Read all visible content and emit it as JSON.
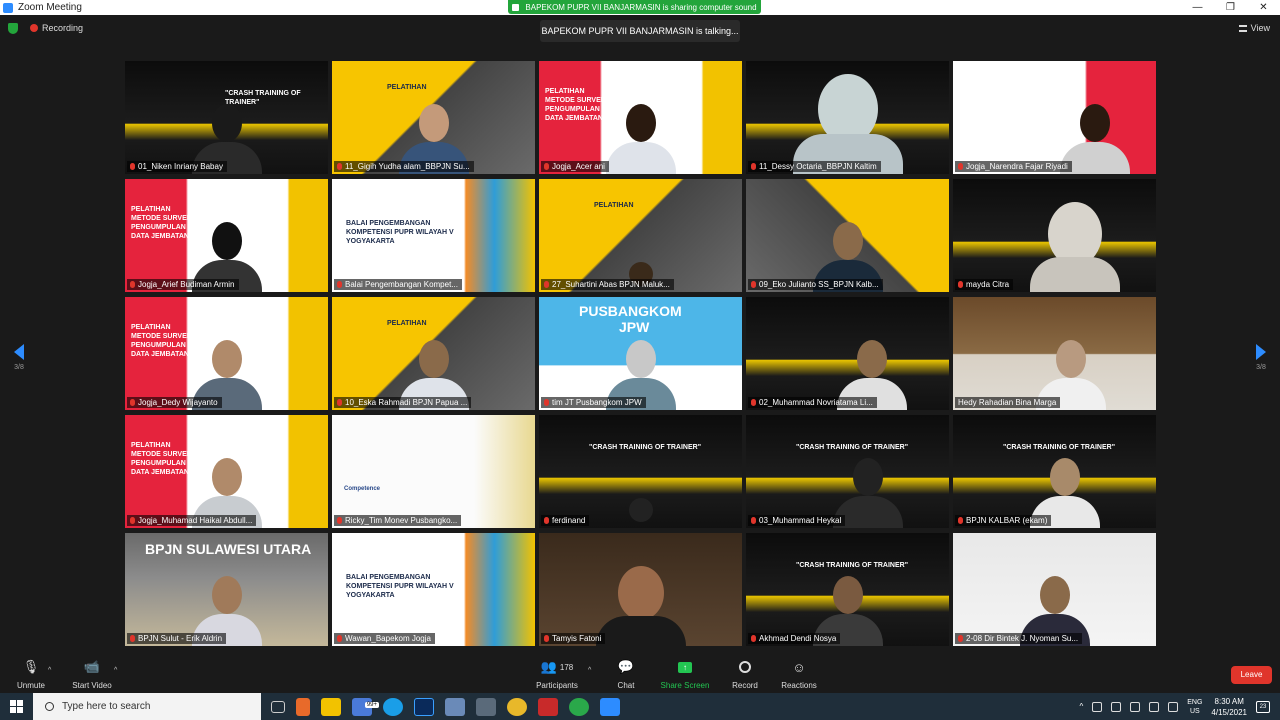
{
  "window": {
    "title": "Zoom Meeting",
    "controls": [
      "—",
      "❐",
      "✕"
    ]
  },
  "share_banner": "BAPEKOM PUPR VII BANJARMASIN is sharing computer sound",
  "recording_label": "Recording",
  "talking_indicator": "BAPEKOM PUPR VII BANJARMASIN is talking...",
  "view_label": "View",
  "pagination": {
    "left": "3/8",
    "right": "3/8"
  },
  "tiles": [
    {
      "name": "01_Niken Inriany Babay",
      "muted": true
    },
    {
      "name": "11_Gigih Yudha alam_BBPJN Su...",
      "muted": true
    },
    {
      "name": "Jogja_Acer ani",
      "muted": true
    },
    {
      "name": "11_Dessy Octaria_BBPJN Kaltim",
      "muted": true
    },
    {
      "name": "Jogja_Narendra Fajar Riyadi",
      "muted": true
    },
    {
      "name": "Jogja_Arief Budiman Armin",
      "muted": true
    },
    {
      "name": "Balai Pengembangan Kompet...",
      "muted": true
    },
    {
      "name": "27_Suhartini Abas BPJN Maluk...",
      "muted": true
    },
    {
      "name": "09_Eko Julianto SS_BPJN Kalb...",
      "muted": true
    },
    {
      "name": "mayda Citra",
      "muted": true
    },
    {
      "name": "Jogja_Dedy Wijayanto",
      "muted": true
    },
    {
      "name": "10_Eska Rahmadi BPJN Papua ...",
      "muted": true
    },
    {
      "name": "tim JT Pusbangkom JPW",
      "muted": true
    },
    {
      "name": "02_Muhammad Novriatama Li...",
      "muted": true
    },
    {
      "name": "Hedy Rahadian Bina Marga",
      "muted": false
    },
    {
      "name": "Jogja_Muhamad Haikal Abdull...",
      "muted": true
    },
    {
      "name": "Ricky_Tim Monev Pusbangko...",
      "muted": true
    },
    {
      "name": "ferdinand",
      "muted": true
    },
    {
      "name": "03_Muhammad Heykal",
      "muted": true
    },
    {
      "name": "BPJN KALBAR (ekam)",
      "muted": true
    },
    {
      "name": "BPJN Sulut - Erik Aldrin",
      "muted": true
    },
    {
      "name": "Wawan_Bapekom Jogja",
      "muted": true
    },
    {
      "name": "Tamyis Fatoni",
      "muted": true
    },
    {
      "name": "Akhmad Dendi Nosya",
      "muted": true
    },
    {
      "name": "2-08 Dir Bintek J. Nyoman Su...",
      "muted": true
    }
  ],
  "tile_texts": {
    "pelatihan": "PELATIHAN",
    "pelatihan_metode": "PELATIHAN METODE SURVEI PENGUMPULAN DATA JEMBATAN",
    "balai": "BALAI PENGEMBANGAN KOMPETENSI PUPR WILAYAH V YOGYAKARTA",
    "pusbangkom": "PUSBANGKOM",
    "jpw": "JPW",
    "bpjn_sulut": "BPJN SULAWESI UTARA",
    "crash": "\"CRASH TRAINING OF TRAINER\"",
    "competence": "Competence"
  },
  "toolbar": {
    "unmute": "Unmute",
    "start_video": "Start Video",
    "participants": "Participants",
    "participants_count": "178",
    "chat": "Chat",
    "share_screen": "Share Screen",
    "record": "Record",
    "reactions": "Reactions",
    "leave": "Leave"
  },
  "taskbar": {
    "search_placeholder": "Type here to search",
    "badge": "99+",
    "lang_top": "ENG",
    "lang_bottom": "US",
    "time": "8:30 AM",
    "date": "4/15/2021",
    "notifications": "23"
  },
  "colors": {
    "zoom_blue": "#2d8cff",
    "share_green": "#23a53b",
    "leave_red": "#e0352b",
    "talk_yellow": "#f5d300"
  }
}
